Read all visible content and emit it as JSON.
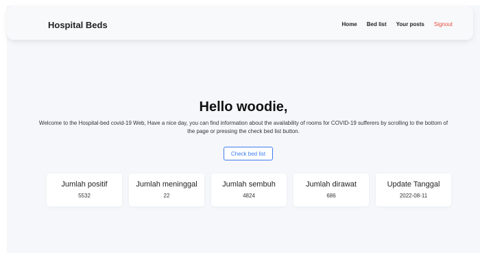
{
  "navbar": {
    "brand": "Hospital Beds",
    "links": [
      {
        "label": "Home"
      },
      {
        "label": "Bed list"
      },
      {
        "label": "Your posts"
      },
      {
        "label": "Signout"
      }
    ]
  },
  "hero": {
    "greeting": "Hello woodie,",
    "description": "Welcome to the Hospital-bed covid-19 Web, Have a nice day, you can find information about the availability of rooms for COVID-19 sufferers by scrolling to the bottom of the page or pressing the check bed list button.",
    "button_label": "Check bed list"
  },
  "stats": [
    {
      "title": "Jumlah positif",
      "value": "5532"
    },
    {
      "title": "Jumlah meninggal",
      "value": "22"
    },
    {
      "title": "Jumlah sembuh",
      "value": "4824"
    },
    {
      "title": "Jumlah dirawat",
      "value": "686"
    },
    {
      "title": "Update Tanggal",
      "value": "2022-08-11"
    }
  ],
  "colors": {
    "accent": "#3d7bf0",
    "signout": "#e74c3c",
    "background": "#f5f7fb"
  }
}
